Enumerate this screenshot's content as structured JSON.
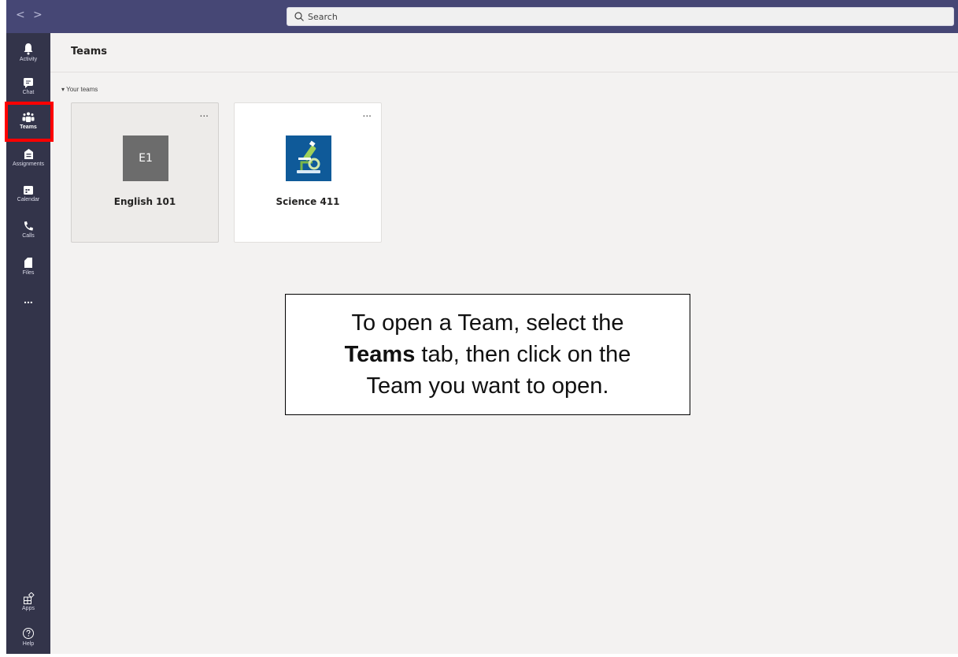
{
  "topbar": {
    "back_icon": "chevron-left-icon",
    "forward_icon": "chevron-right-icon",
    "back_label": "<",
    "forward_label": ">",
    "search": {
      "placeholder": "Search",
      "icon": "search-icon"
    }
  },
  "rail": {
    "items": [
      {
        "label": "Activity",
        "icon": "bell-icon"
      },
      {
        "label": "Chat",
        "icon": "chat-icon"
      },
      {
        "label": "Teams",
        "icon": "teams-icon",
        "active": true
      },
      {
        "label": "Assignments",
        "icon": "assignments-icon"
      },
      {
        "label": "Calendar",
        "icon": "calendar-icon"
      },
      {
        "label": "Calls",
        "icon": "phone-icon"
      },
      {
        "label": "Files",
        "icon": "file-icon"
      },
      {
        "label": "...",
        "icon": "more-icon"
      }
    ],
    "bottom": [
      {
        "label": "Apps",
        "icon": "apps-icon"
      },
      {
        "label": "Help",
        "icon": "help-icon"
      }
    ]
  },
  "main": {
    "title": "Teams",
    "section_label": "Your teams",
    "teams": [
      {
        "name": "English 101",
        "initials": "E1",
        "more": "...",
        "selected": true
      },
      {
        "name": "Science 411",
        "image": "microscope-icon",
        "more": "...",
        "selected": false
      }
    ]
  },
  "callout": {
    "line1": "To open a Team, select the",
    "bold": "Teams",
    "line2_rest": " tab, then click on the",
    "line3": "Team you want to open."
  },
  "colors": {
    "topbar": "#464775",
    "rail": "#33344a",
    "main_bg": "#f3f2f1",
    "highlight": "#ff0000",
    "science_tile": "#0f5a99"
  }
}
